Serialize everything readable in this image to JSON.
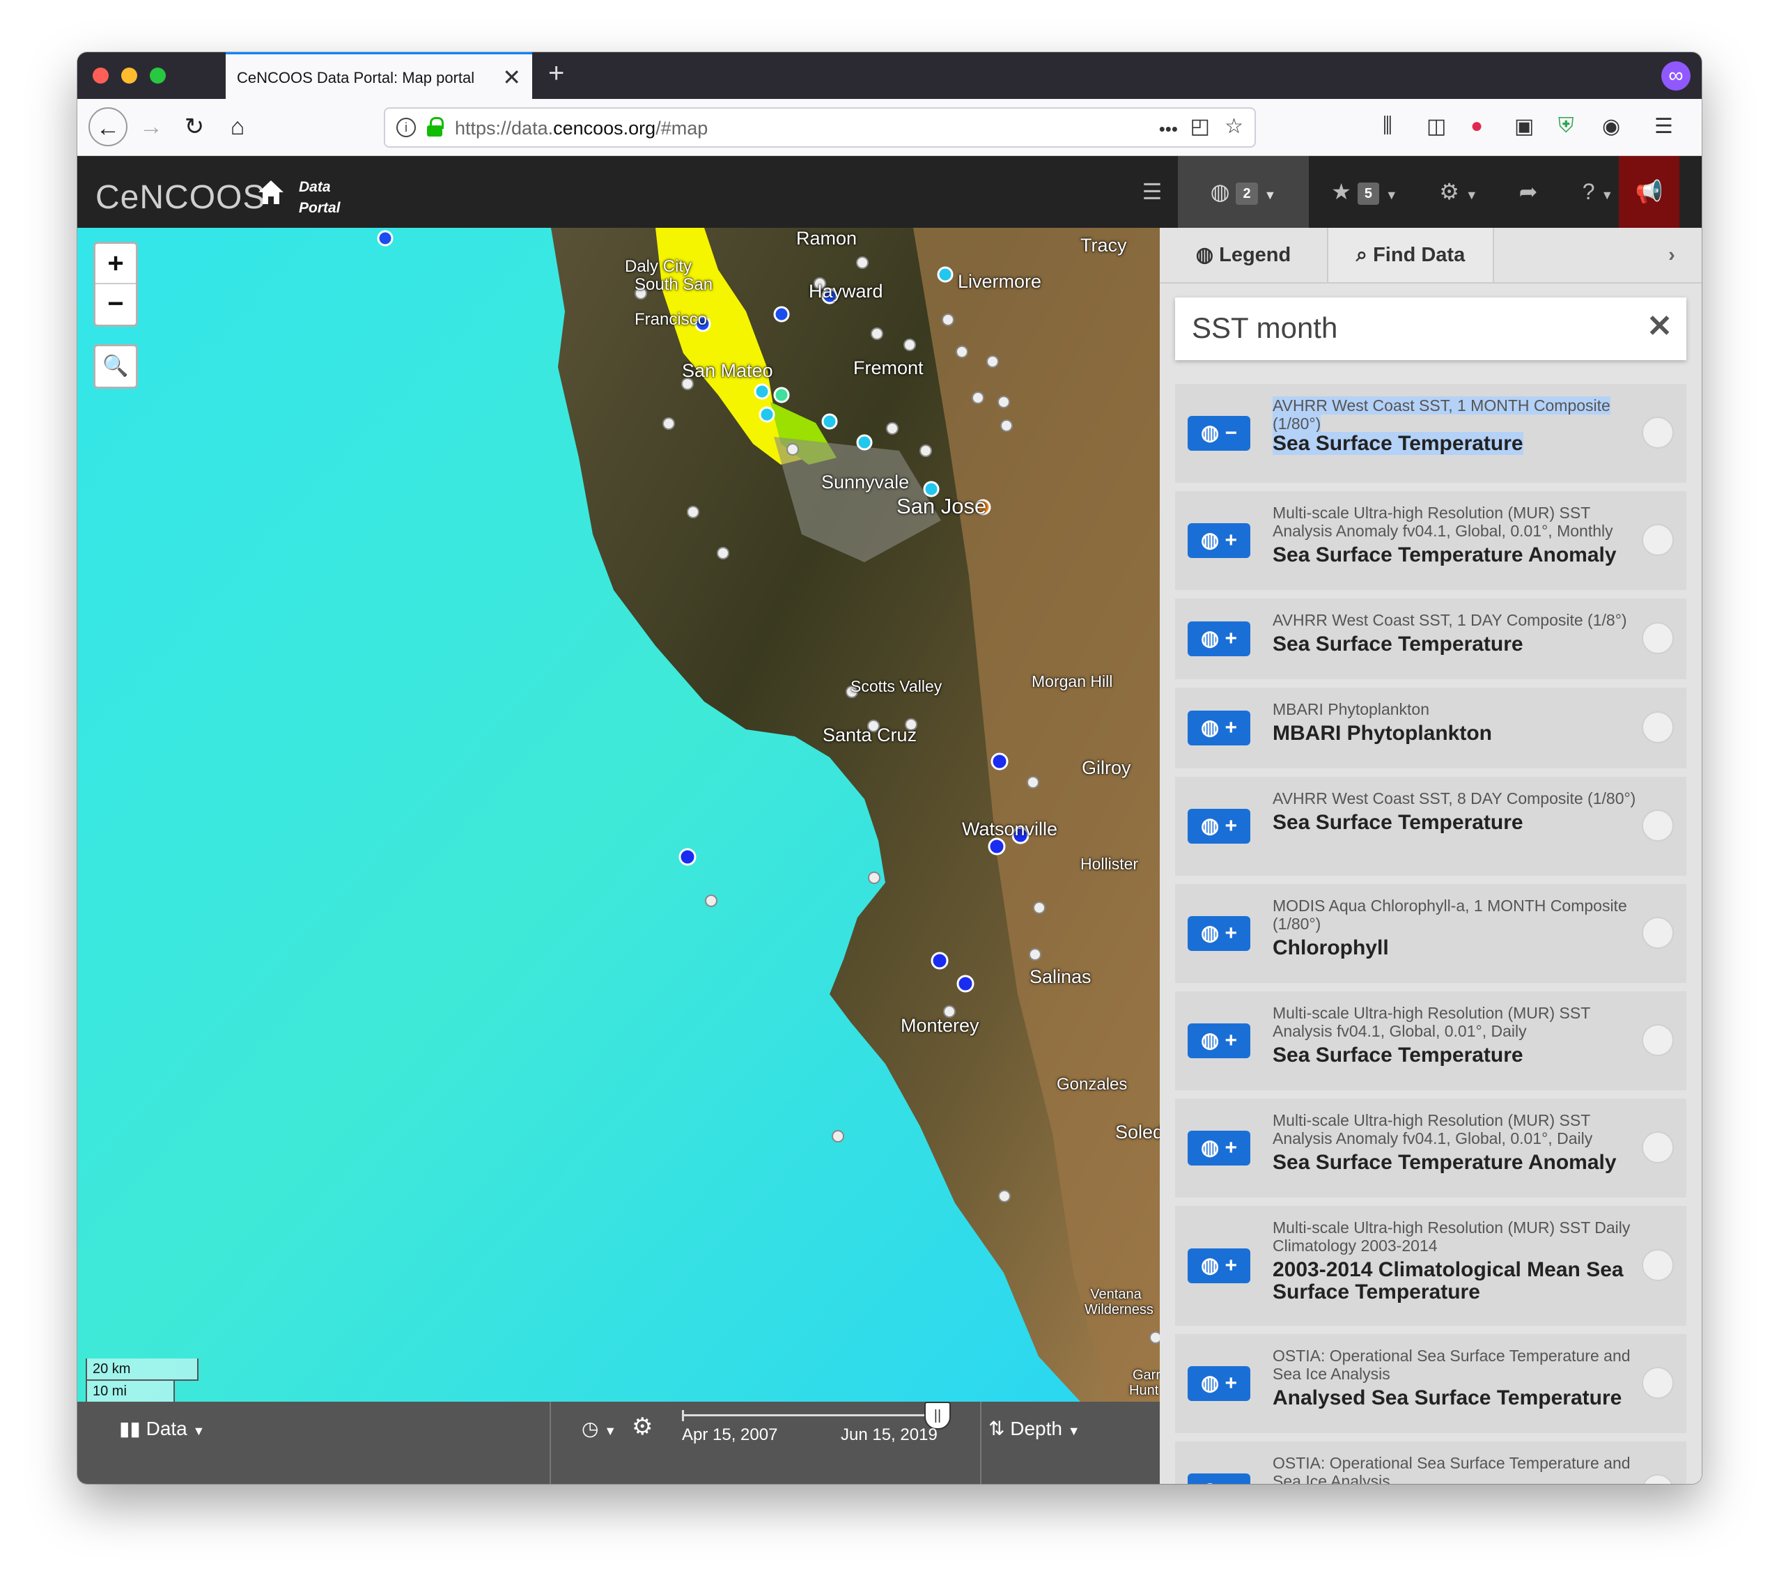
{
  "browser": {
    "tab_title": "CeNCOOS Data Portal: Map portal",
    "url_prefix": "https://data.",
    "url_domain": "cencoos.org",
    "url_path": "/#map",
    "url_more": "•••"
  },
  "app": {
    "logo": "CeNCOOS",
    "subtitle_line1": "Data",
    "subtitle_line2": "Portal",
    "layers_count": "2",
    "favorites_count": "5"
  },
  "map": {
    "zoom_in": "+",
    "zoom_out": "−",
    "scale_km": "20 km",
    "scale_mi": "10 mi",
    "places": [
      "Ramon",
      "Tracy",
      "Livermore",
      "Daly City",
      "South San",
      "Francisco",
      "Hayward",
      "San Mateo",
      "Fremont",
      "Sunnyvale",
      "San Jose",
      "Morgan Hill",
      "Scotts Valley",
      "Santa Cruz",
      "Gilroy",
      "Watsonville",
      "Hollister",
      "Salinas",
      "Monterey",
      "Gonzales",
      "Soledad",
      "Ventana Wilderness",
      "Garr",
      "Hunt"
    ]
  },
  "bottom": {
    "data_label": "Data",
    "start_date": "Apr 15, 2007",
    "end_date": "Jun 15, 2019",
    "depth_label": "Depth"
  },
  "panel": {
    "tab_legend": "Legend",
    "tab_find": "Find Data",
    "search_value": "SST month",
    "results": [
      {
        "title": "AVHRR West Coast SST, 1 MONTH Composite (1/80°)",
        "name": "Sea Surface Temperature",
        "action": "−"
      },
      {
        "title": "Multi-scale Ultra-high Resolution (MUR) SST Analysis Anomaly fv04.1, Global, 0.01°, Monthly",
        "name": "Sea Surface Temperature Anomaly",
        "action": "+"
      },
      {
        "title": "AVHRR West Coast SST, 1 DAY Composite (1/8°)",
        "name": "Sea Surface Temperature",
        "action": "+"
      },
      {
        "title": "MBARI Phytoplankton",
        "name": "MBARI Phytoplankton",
        "action": "+"
      },
      {
        "title": "AVHRR West Coast SST, 8 DAY Composite (1/80°)",
        "name": "Sea Surface Temperature",
        "action": "+"
      },
      {
        "title": "MODIS Aqua Chlorophyll-a, 1 MONTH Composite (1/80°)",
        "name": "Chlorophyll",
        "action": "+"
      },
      {
        "title": "Multi-scale Ultra-high Resolution (MUR) SST Analysis fv04.1, Global, 0.01°, Daily",
        "name": "Sea Surface Temperature",
        "action": "+"
      },
      {
        "title": "Multi-scale Ultra-high Resolution (MUR) SST Analysis Anomaly fv04.1, Global, 0.01°, Daily",
        "name": "Sea Surface Temperature Anomaly",
        "action": "+"
      },
      {
        "title": "Multi-scale Ultra-high Resolution (MUR) SST Daily Climatology 2003-2014",
        "name": "2003-2014 Climatological Mean Sea Surface Temperature",
        "action": "+"
      },
      {
        "title": "OSTIA: Operational Sea Surface Temperature and Sea Ice Analysis",
        "name": "Analysed Sea Surface Temperature",
        "action": "+"
      },
      {
        "title": "OSTIA: Operational Sea Surface Temperature and Sea Ice Analysis",
        "name": "",
        "action": "+"
      }
    ]
  },
  "colors": {
    "accent": "#1a6fd6",
    "appbar": "#232323",
    "alert": "#7a0d0d"
  }
}
